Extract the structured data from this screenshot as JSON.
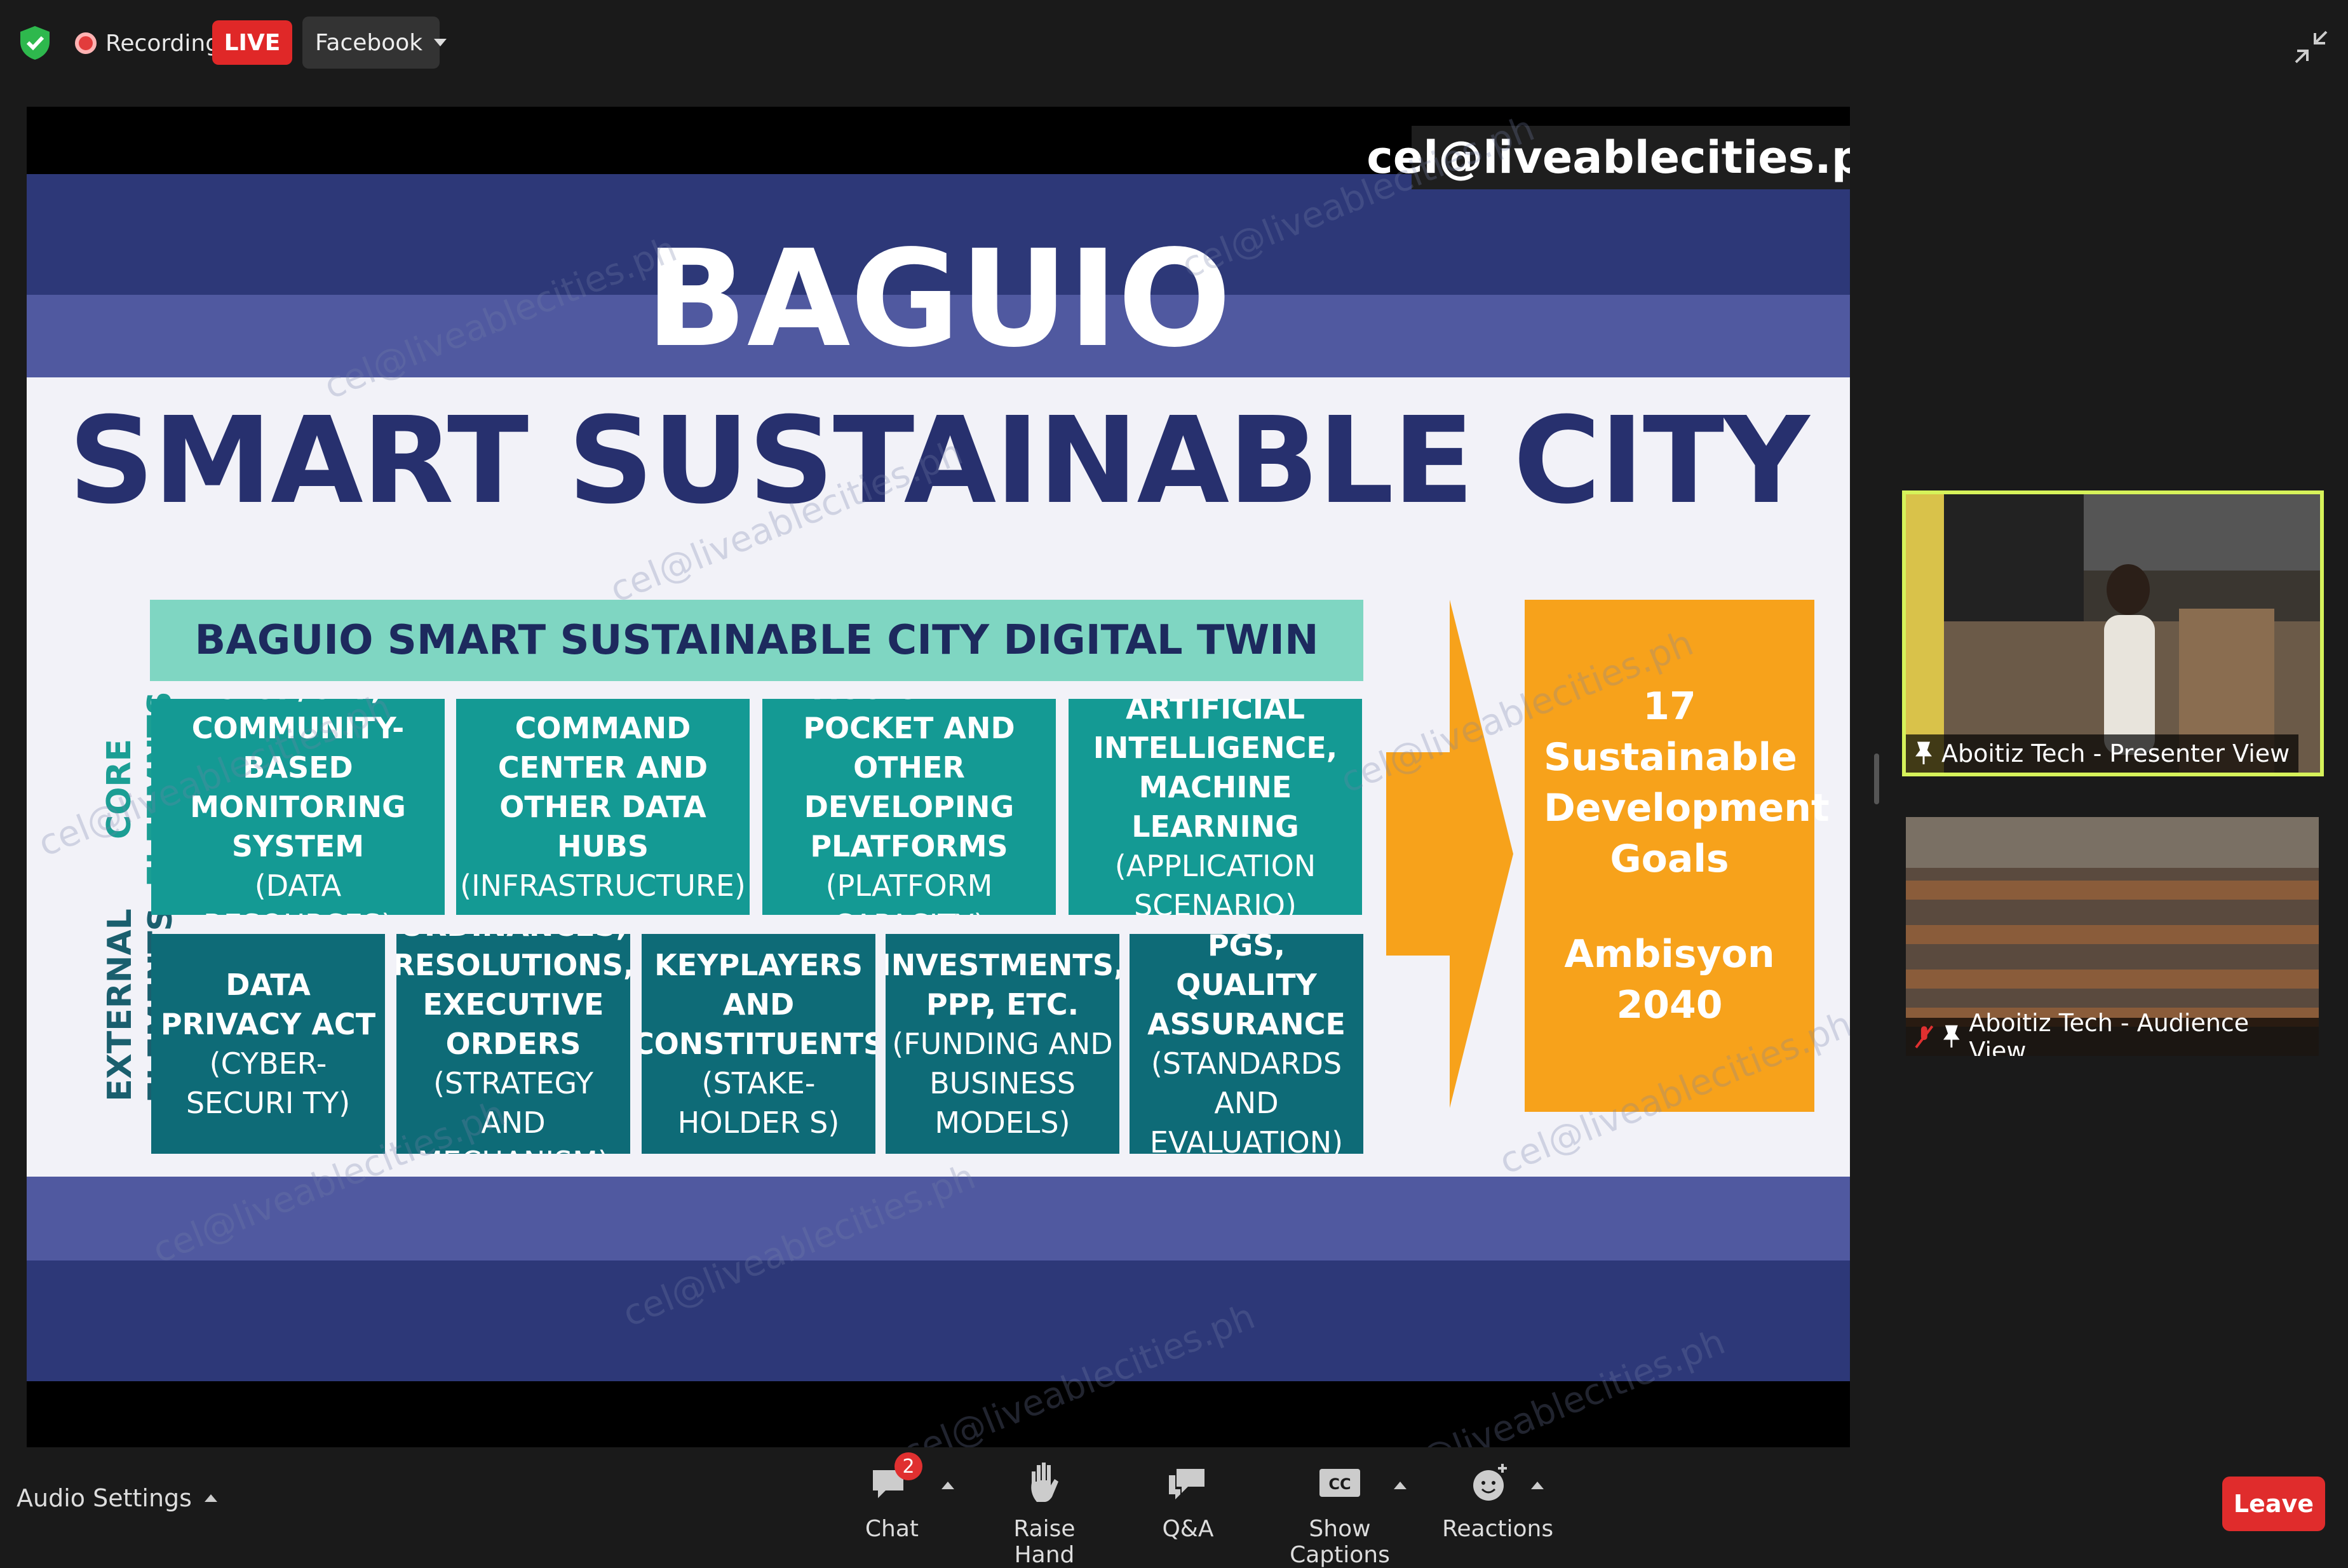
{
  "topbar": {
    "recording_label": "Recording",
    "live_label": "LIVE",
    "stream_dropdown": "Facebook"
  },
  "slide": {
    "email": "cel@liveablecities.ph",
    "title_line1": "BAGUIO",
    "title_line2": "SMART SUSTAINABLE CITY",
    "digital_twin": "BAGUIO SMART SUSTAINABLE CITY DIGITAL TWIN",
    "core_label_1": "CORE",
    "core_label_2": "ELEEMNTS",
    "external_label_1": "EXTERNAL",
    "external_label_2": "ELEMENTS",
    "core": [
      {
        "title": "CLUP/CDP, COMMUNITY-BASED MONITORING SYSTEM",
        "sub": "(DATA RESOURCES)"
      },
      {
        "title": "COMMAND CENTER AND OTHER DATA HUBS",
        "sub": "(INFRASTRUCTURE)"
      },
      {
        "title": "BAGUIO IN MY POCKET AND OTHER DEVELOPING PLATFORMS",
        "sub": "(PLATFORM CAPACITY)"
      },
      {
        "title": "ARTIFICIAL INTELLIGENCE, MACHINE LEARNING",
        "sub": "(APPLICATION SCENARIO)"
      }
    ],
    "external": [
      {
        "title": "DATA PRIVACY ACT",
        "sub": "(CYBER-SECURI TY)"
      },
      {
        "title": "ORDINANCES, RESOLUTIONS, EXECUTIVE ORDERS",
        "sub": "(STRATEGY AND MECHANISM)"
      },
      {
        "title": "KEYPLAYERS AND CONSTITUENTS",
        "sub": "(STAKE-HOLDER S)"
      },
      {
        "title": "INVESTMENTS, PPP, ETC.",
        "sub": "(FUNDING AND BUSINESS MODELS)"
      },
      {
        "title": "PGS, QUALITY ASSURANCE",
        "sub": "(STANDARDS AND EVALUATION)"
      }
    ],
    "sdg_text": "17 Sustainable Development Goals",
    "ambisyon": "Ambisyon 2040",
    "watermark": "cel@liveablecities.ph"
  },
  "participants": [
    {
      "name": "Aboitiz Tech - Presenter View"
    },
    {
      "name": "Aboitiz Tech - Audience View"
    }
  ],
  "bottombar": {
    "audio_settings": "Audio Settings",
    "chat": "Chat",
    "chat_badge": "2",
    "raise_hand": "Raise Hand",
    "qa": "Q&A",
    "captions": "Show Captions",
    "cc_icon_text": "CC",
    "reactions": "Reactions",
    "leave": "Leave"
  },
  "colors": {
    "slide_navy": "#2d3878",
    "slide_teal": "#149a94",
    "slide_dark_teal": "#0e6b77",
    "slide_orange": "#f7a21b",
    "live_red": "#e02828",
    "active_speaker": "#d6f25a"
  }
}
